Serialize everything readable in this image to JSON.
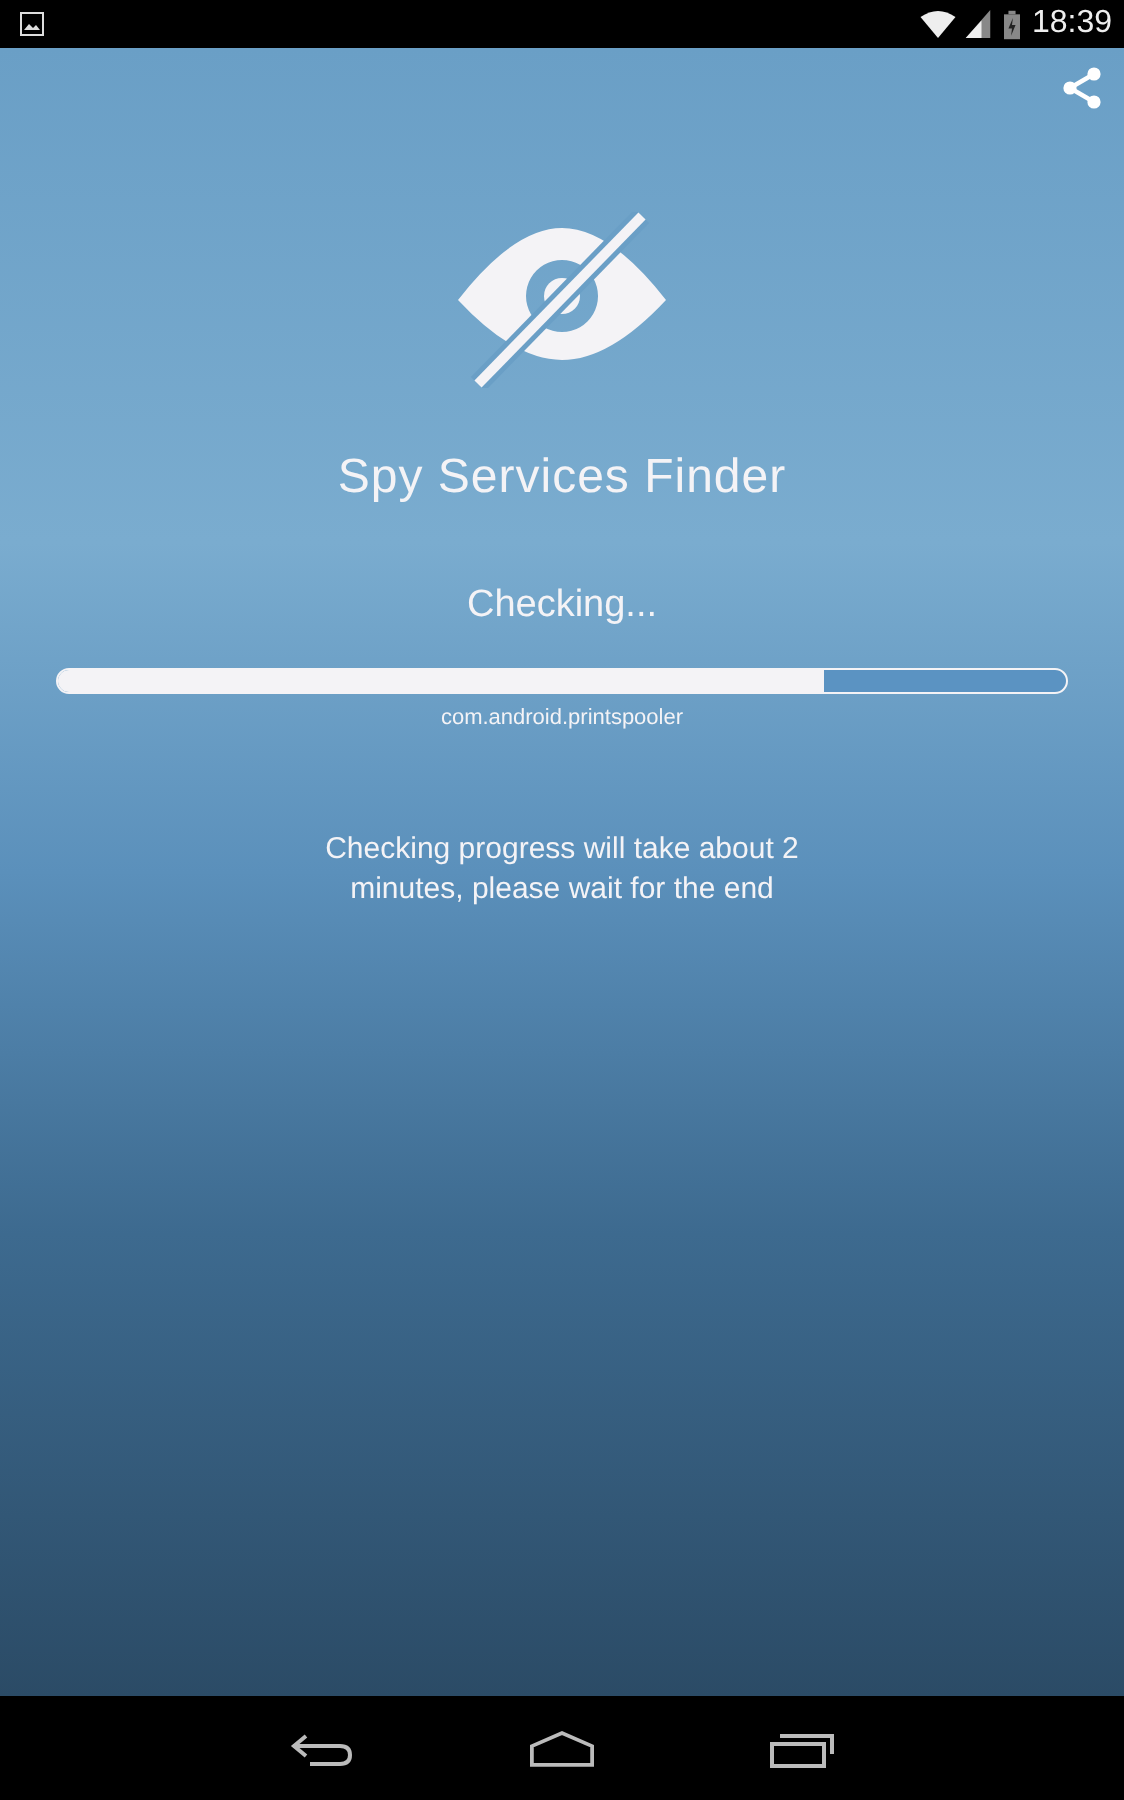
{
  "status_bar": {
    "time": "18:39"
  },
  "app": {
    "title": "Spy Services Finder",
    "status": "Checking...",
    "progress": {
      "level": 0.76,
      "current_item": "com.android.printspooler"
    },
    "note": "Checking progress will take about 2 minutes, please wait for the end"
  }
}
